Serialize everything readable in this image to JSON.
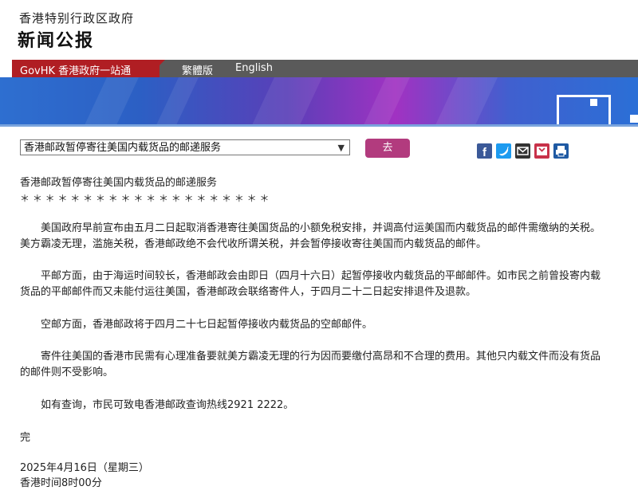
{
  "header": {
    "gov_name": "香港特别行政区政府",
    "section_title": "新闻公报"
  },
  "nav": {
    "govhk_label": "GovHK 香港政府一站通",
    "traditional_label": "繁體版",
    "english_label": "English"
  },
  "press_select": {
    "selected": "香港邮政暂停寄往美国内载货品的邮递服务",
    "go_label": "去"
  },
  "share": {
    "icons": [
      "facebook-icon",
      "twitter-icon",
      "email-icon",
      "bookmark-icon",
      "print-icon"
    ]
  },
  "article": {
    "title": "香港邮政暂停寄往美国内载货品的邮递服务",
    "stars": "＊ ＊ ＊ ＊ ＊ ＊ ＊ ＊ ＊ ＊ ＊ ＊ ＊ ＊ ＊ ＊ ＊ ＊ ＊ ＊",
    "p1": "美国政府早前宣布由五月二日起取消香港寄往美国货品的小额免税安排，并调高付运美国而内载货品的邮件需缴纳的关税。美方霸凌无理，滥施关税，香港邮政绝不会代收所谓关税，并会暂停接收寄往美国而内载货品的邮件。",
    "p2": "平邮方面，由于海运时间较长，香港邮政会由即日（四月十六日）起暂停接收内载货品的平邮邮件。如市民之前曾投寄内载货品的平邮邮件而又未能付运往美国，香港邮政会联络寄件人，于四月二十二日起安排退件及退款。",
    "p3": "空邮方面，香港邮政将于四月二十七日起暂停接收内载货品的空邮邮件。",
    "p4": "寄件往美国的香港市民需有心理准备要就美方霸凌无理的行为因而要缴付高昂和不合理的费用。其他只内载文件而没有货品的邮件则不受影响。",
    "p5": "如有查询，市民可致电香港邮政查询热线2921 2222。",
    "end_mark": "完",
    "date": "2025年4月16日（星期三）",
    "time": "香港时间8时00分"
  }
}
